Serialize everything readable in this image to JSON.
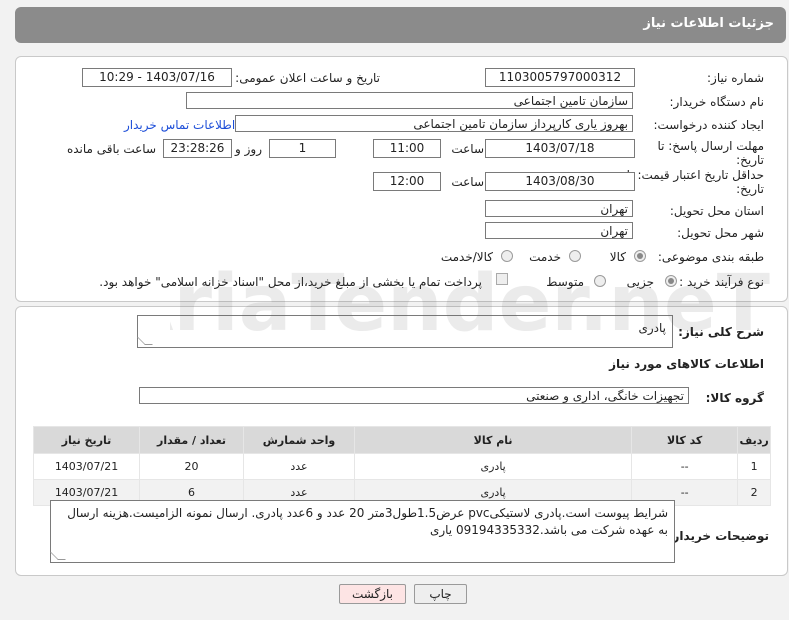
{
  "header": {
    "title": "جزئیات اطلاعات نیاز"
  },
  "form": {
    "need_number_label": "شماره نیاز:",
    "need_number": "1103005797000312",
    "announce_label": "تاریخ و ساعت اعلان عمومی:",
    "announce_value": "1403/07/16 - 10:29",
    "buyer_org_label": "نام دستگاه خریدار:",
    "buyer_org": "سازمان تامین اجتماعی",
    "creator_label": "ایجاد کننده درخواست:",
    "creator": "بهروز یاری کارپرداز سازمان تامین اجتماعی",
    "contact_link": "اطلاعات تماس خریدار",
    "deadline_label_1": "مهلت ارسال پاسخ: تا",
    "deadline_label_2": "تاریخ:",
    "deadline_date": "1403/07/18",
    "time_label": "ساعت",
    "deadline_time": "11:00",
    "days_value": "1",
    "days_label": "روز و",
    "remaining_time": "23:28:26",
    "remaining_label": "ساعت باقی مانده",
    "validity_label_1": "حداقل تاریخ اعتبار قیمت: تا",
    "validity_label_2": "تاریخ:",
    "validity_date": "1403/08/30",
    "validity_time": "12:00",
    "province_label": "استان محل تحویل:",
    "province": "تهران",
    "city_label": "شهر محل تحویل:",
    "city": "تهران",
    "category_label": "طبقه بندی موضوعی:",
    "category_options": [
      "کالا",
      "خدمت",
      "کالا/خدمت"
    ],
    "process_label": "نوع فرآیند خرید :",
    "process_options": [
      "جزیی",
      "متوسط"
    ],
    "payment_note": "پرداخت تمام یا بخشی از مبلغ خرید،از محل \"اسناد خزانه اسلامی\" خواهد بود."
  },
  "details": {
    "summary_label": "شرح کلی نیاز:",
    "summary": "پادری",
    "items_title": "اطلاعات کالاهای مورد نیاز",
    "group_label": "گروه کالا:",
    "group_value": "تجهیزات خانگی، اداری و صنعتی",
    "table": {
      "headers": [
        "ردیف",
        "کد کالا",
        "نام کالا",
        "واحد شمارش",
        "تعداد / مقدار",
        "تاریخ نیاز"
      ],
      "rows": [
        [
          "1",
          "--",
          "پادری",
          "عدد",
          "20",
          "1403/07/21"
        ],
        [
          "2",
          "--",
          "پادری",
          "عدد",
          "6",
          "1403/07/21"
        ]
      ]
    },
    "buyer_notes_label": "توضیحات خریدار:",
    "buyer_notes": "شرایط پیوست است.پادری لاستیکیpvc عرض1.5طول3متر 20 عدد و 6عدد پادری. ارسال نمونه الزامیست.هزینه ارسال به عهده شرکت می باشد.09194335332 یاری"
  },
  "buttons": {
    "print": "چاپ",
    "back": "بازگشت"
  },
  "watermark": "AriaTender.neT",
  "colors": {
    "header": "#8b8b8b",
    "link": "#1d4ed8",
    "back_button": "#fde4e4",
    "print_button": "#eeeeee"
  }
}
